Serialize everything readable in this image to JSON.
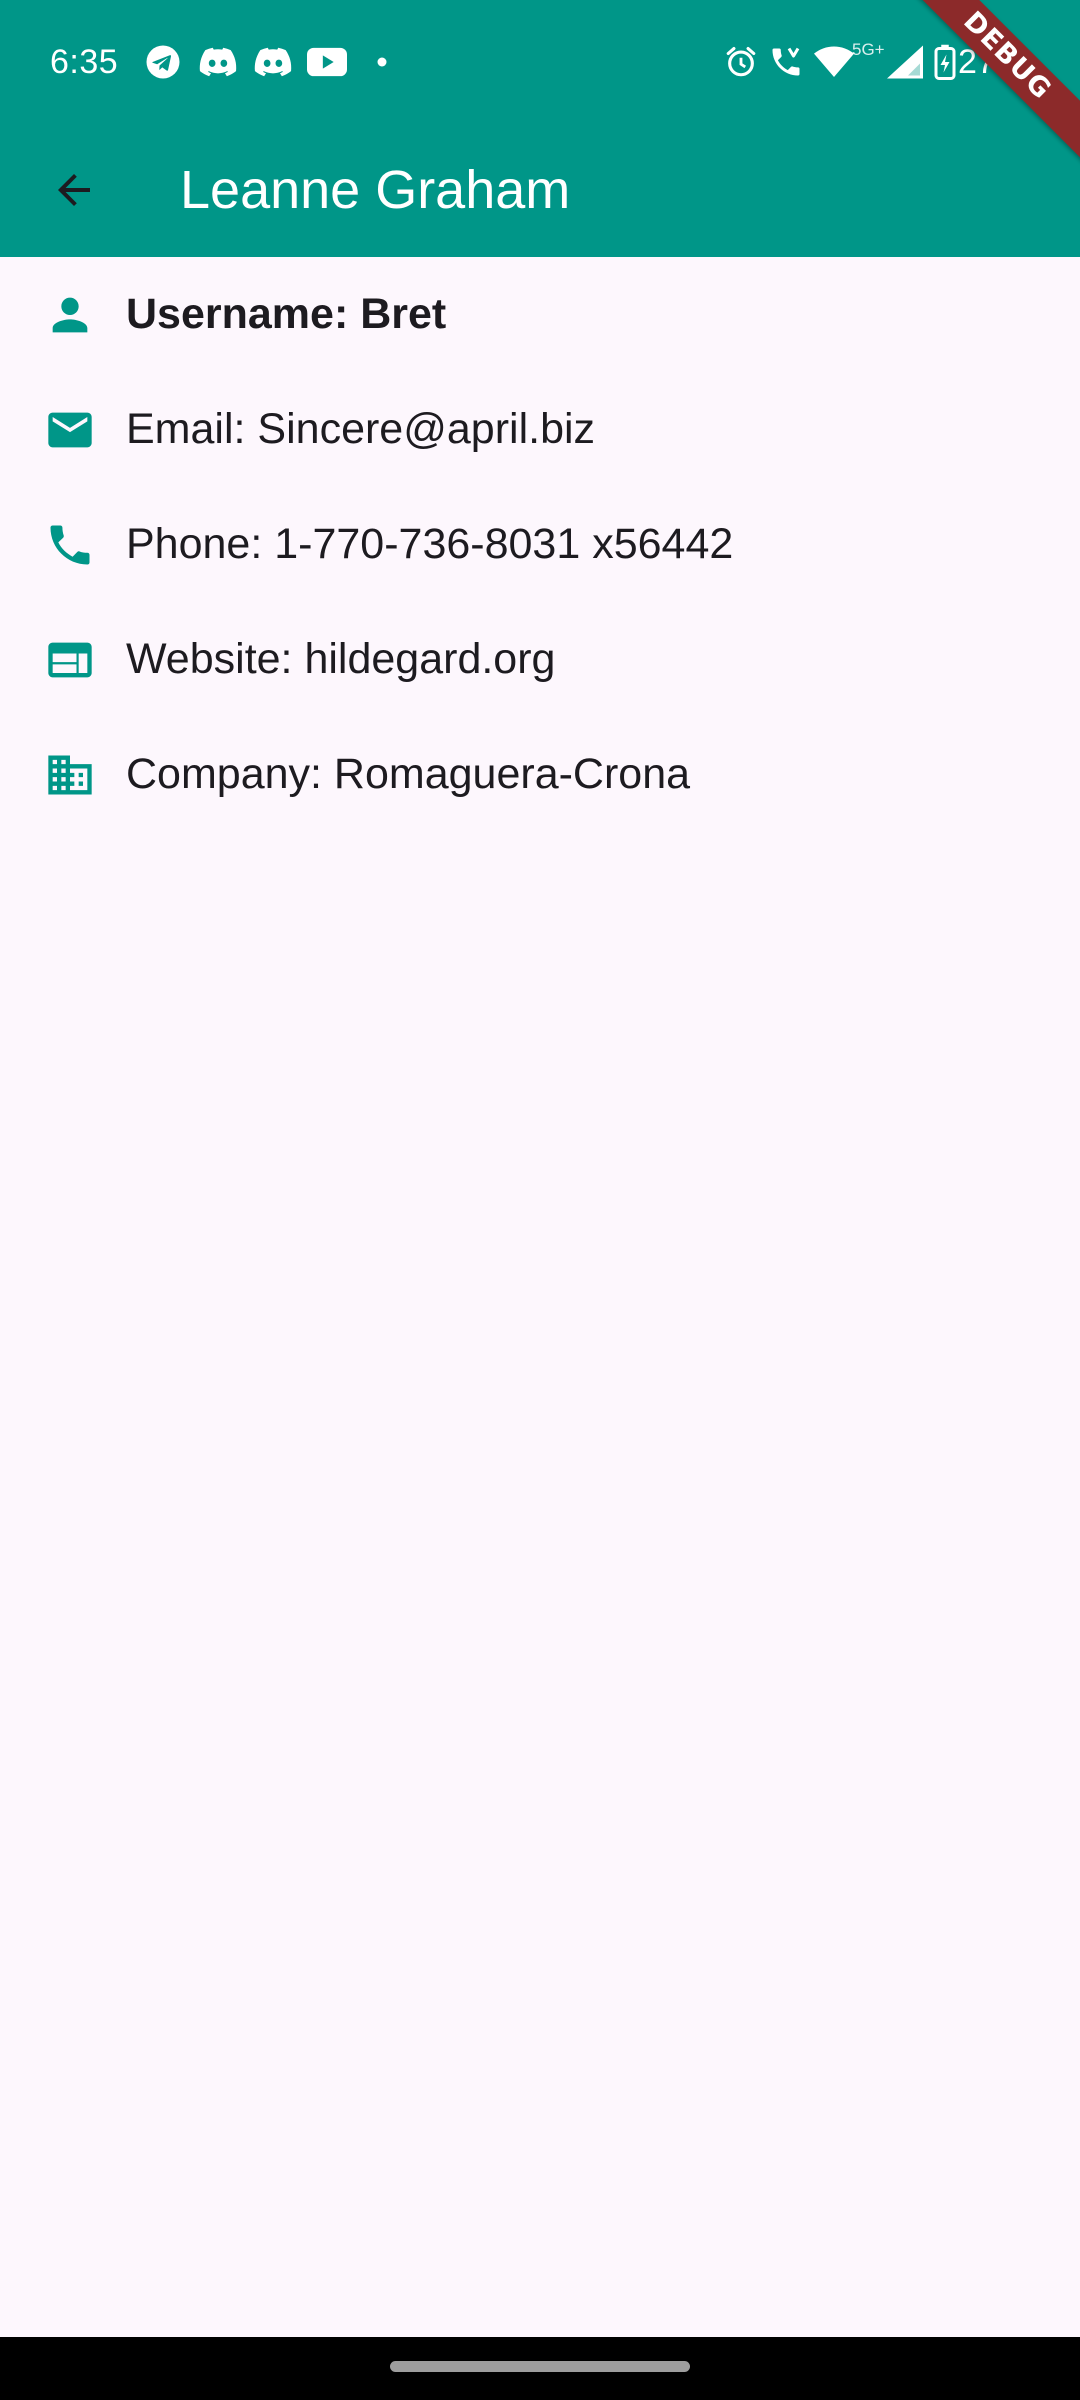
{
  "status_bar": {
    "time": "6:35",
    "battery_percent": "27%",
    "network_label": "5G+",
    "notification_icons": [
      "telegram-icon",
      "discord-icon",
      "discord-icon",
      "youtube-icon",
      "dot-icon"
    ],
    "system_icons": [
      "alarm-icon",
      "wifi-calling-icon",
      "wifi-icon",
      "signal-icon",
      "battery-charging-icon"
    ]
  },
  "app_bar": {
    "back_icon": "arrow-back-icon",
    "title": "Leanne Graham"
  },
  "debug_banner": "DEBUG",
  "details": [
    {
      "icon": "person-icon",
      "text": "Username: Bret"
    },
    {
      "icon": "email-icon",
      "text": "Email: Sincere@april.biz"
    },
    {
      "icon": "phone-icon",
      "text": "Phone: 1-770-736-8031 x56442"
    },
    {
      "icon": "web-icon",
      "text": "Website: hildegard.org"
    },
    {
      "icon": "business-icon",
      "text": "Company: Romaguera-Crona"
    }
  ],
  "colors": {
    "primary": "#009688",
    "background": "#fdf7fd",
    "text": "#1d1b20",
    "debug_banner": "#8c2a2a"
  }
}
